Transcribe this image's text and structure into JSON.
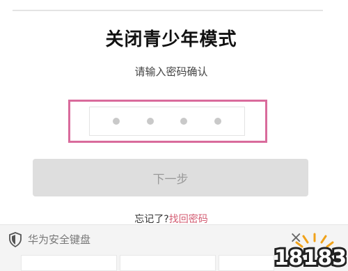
{
  "header": {
    "title": "关闭青少年模式"
  },
  "prompt": {
    "text": "请输入密码确认"
  },
  "pin": {
    "dots": 4
  },
  "actions": {
    "next_label": "下一步"
  },
  "forgot": {
    "text": "忘记了?",
    "link": "找回密码"
  },
  "keyboard": {
    "title": "华为安全键盘",
    "close_icon": "×"
  },
  "watermark": {
    "text": "18183"
  },
  "colors": {
    "accent": "#d96b9c",
    "link": "#d35c72",
    "button_bg": "#dedede"
  }
}
